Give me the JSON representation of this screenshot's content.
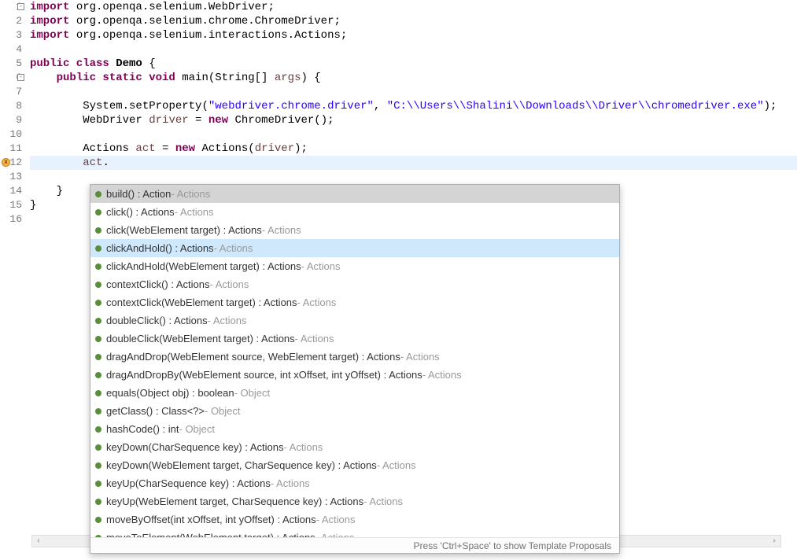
{
  "lines": [
    {
      "n": 1,
      "fold": "⊟",
      "tokens": [
        [
          "kw",
          "import"
        ],
        [
          "",
          " org.openqa.selenium.WebDriver;"
        ]
      ]
    },
    {
      "n": 2,
      "tokens": [
        [
          "kw",
          "import"
        ],
        [
          "",
          " org.openqa.selenium.chrome.ChromeDriver;"
        ]
      ]
    },
    {
      "n": 3,
      "tokens": [
        [
          "kw",
          "import"
        ],
        [
          "",
          " org.openqa.selenium.interactions.Actions;"
        ]
      ]
    },
    {
      "n": 4,
      "tokens": []
    },
    {
      "n": 5,
      "tokens": [
        [
          "kw",
          "public class "
        ],
        [
          "meth",
          "Demo"
        ],
        [
          "",
          " {"
        ]
      ]
    },
    {
      "n": 6,
      "fold": "⊟",
      "tokens": [
        [
          "",
          "    "
        ],
        [
          "kw",
          "public static void"
        ],
        [
          "",
          " main(String[] "
        ],
        [
          "varname",
          "args"
        ],
        [
          "",
          ") {"
        ]
      ]
    },
    {
      "n": 7,
      "tokens": []
    },
    {
      "n": 8,
      "tokens": [
        [
          "",
          "        System."
        ],
        [
          "",
          "setProperty"
        ],
        [
          "",
          "("
        ],
        [
          "str",
          "\"webdriver.chrome.driver\""
        ],
        [
          "",
          ", "
        ],
        [
          "str",
          "\"C:\\\\Users\\\\Shalini\\\\Downloads\\\\Driver\\\\chromedriver.exe\""
        ],
        [
          "",
          ");"
        ]
      ]
    },
    {
      "n": 9,
      "tokens": [
        [
          "",
          "        WebDriver "
        ],
        [
          "varname",
          "driver"
        ],
        [
          "",
          " = "
        ],
        [
          "kw",
          "new"
        ],
        [
          "",
          " ChromeDriver();"
        ]
      ]
    },
    {
      "n": 10,
      "tokens": []
    },
    {
      "n": 11,
      "tokens": [
        [
          "",
          "        Actions "
        ],
        [
          "varname",
          "act"
        ],
        [
          "",
          " = "
        ],
        [
          "kw",
          "new"
        ],
        [
          "",
          " Actions("
        ],
        [
          "varname",
          "driver"
        ],
        [
          "",
          ");"
        ]
      ]
    },
    {
      "n": 12,
      "highlight": true,
      "marker": true,
      "tokens": [
        [
          "",
          "        "
        ],
        [
          "varname",
          "act"
        ],
        [
          "",
          "."
        ]
      ]
    },
    {
      "n": 13,
      "tokens": []
    },
    {
      "n": 14,
      "tokens": [
        [
          "",
          "    }"
        ]
      ]
    },
    {
      "n": 15,
      "tokens": [
        [
          "",
          "}"
        ]
      ]
    },
    {
      "n": 16,
      "tokens": []
    }
  ],
  "autocomplete": {
    "items": [
      {
        "main": "build() : Action",
        "origin": "Actions",
        "selTop": true
      },
      {
        "main": "click() : Actions",
        "origin": "Actions"
      },
      {
        "main": "click(WebElement target) : Actions",
        "origin": "Actions"
      },
      {
        "main": "clickAndHold() : Actions",
        "origin": "Actions",
        "selHover": true
      },
      {
        "main": "clickAndHold(WebElement target) : Actions",
        "origin": "Actions"
      },
      {
        "main": "contextClick() : Actions",
        "origin": "Actions"
      },
      {
        "main": "contextClick(WebElement target) : Actions",
        "origin": "Actions"
      },
      {
        "main": "doubleClick() : Actions",
        "origin": "Actions"
      },
      {
        "main": "doubleClick(WebElement target) : Actions",
        "origin": "Actions"
      },
      {
        "main": "dragAndDrop(WebElement source, WebElement target) : Actions",
        "origin": "Actions"
      },
      {
        "main": "dragAndDropBy(WebElement source, int xOffset, int yOffset) : Actions",
        "origin": "Actions"
      },
      {
        "main": "equals(Object obj) : boolean",
        "origin": "Object"
      },
      {
        "main": "getClass() : Class<?>",
        "origin": "Object"
      },
      {
        "main": "hashCode() : int",
        "origin": "Object"
      },
      {
        "main": "keyDown(CharSequence key) : Actions",
        "origin": "Actions"
      },
      {
        "main": "keyDown(WebElement target, CharSequence key) : Actions",
        "origin": "Actions"
      },
      {
        "main": "keyUp(CharSequence key) : Actions",
        "origin": "Actions"
      },
      {
        "main": "keyUp(WebElement target, CharSequence key) : Actions",
        "origin": "Actions"
      },
      {
        "main": "moveByOffset(int xOffset, int yOffset) : Actions",
        "origin": "Actions"
      },
      {
        "main": "moveToElement(WebElement target) : Actions",
        "origin": "Actions"
      }
    ],
    "footer": "Press 'Ctrl+Space' to show Template Proposals"
  }
}
